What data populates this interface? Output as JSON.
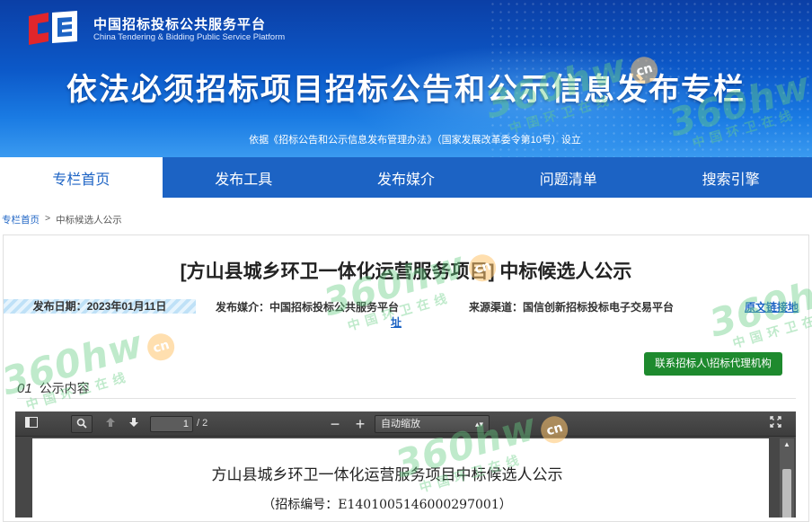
{
  "header": {
    "site_name_cn": "中国招标投标公共服务平台",
    "site_name_en": "China Tendering & Bidding Public Service Platform",
    "main_title": "依法必须招标项目招标公告和公示信息发布专栏",
    "basis": "依据《招标公告和公示信息发布管理办法》（国家发展改革委令第10号）设立",
    "brand_colors": {
      "primary": "#1c63c4",
      "logo_red": "#e0262b"
    }
  },
  "nav": {
    "items": [
      {
        "label": "专栏首页",
        "active": true
      },
      {
        "label": "发布工具",
        "active": false
      },
      {
        "label": "发布媒介",
        "active": false
      },
      {
        "label": "问题清单",
        "active": false
      },
      {
        "label": "搜索引擎",
        "active": false
      }
    ]
  },
  "breadcrumb": {
    "home": "专栏首页",
    "separator": ">",
    "current": "中标候选人公示"
  },
  "article": {
    "title": "[方山县城乡环卫一体化运营服务项目] 中标候选人公示",
    "publish_date": "发布日期：2023年01月11日",
    "media_main": "发布媒介：中国招标投标公共服务平台",
    "media_tail": "址",
    "channel": "来源渠道：国信创新招标投标电子交易平台",
    "original_link": "原文链接地",
    "contact_button": "联系招标人\\招标代理机构",
    "section_number": "01",
    "section_label": "公示内容"
  },
  "viewer": {
    "page_current": "1",
    "page_total": "/ 2",
    "zoom_label": "自动缩放",
    "toolbar_icons": [
      "sidebar-toggle-icon",
      "search-icon",
      "previous-page-icon",
      "next-page-icon",
      "zoom-out-icon",
      "zoom-in-icon",
      "fullscreen-icon"
    ],
    "doc_title": "方山县城乡环卫一体化运营服务项目中标候选人公示",
    "doc_code": "（招标编号：E1401005146000297001）"
  },
  "watermark": {
    "text": "360hw",
    "sub": "中国环卫在线",
    "badge": "cn"
  }
}
